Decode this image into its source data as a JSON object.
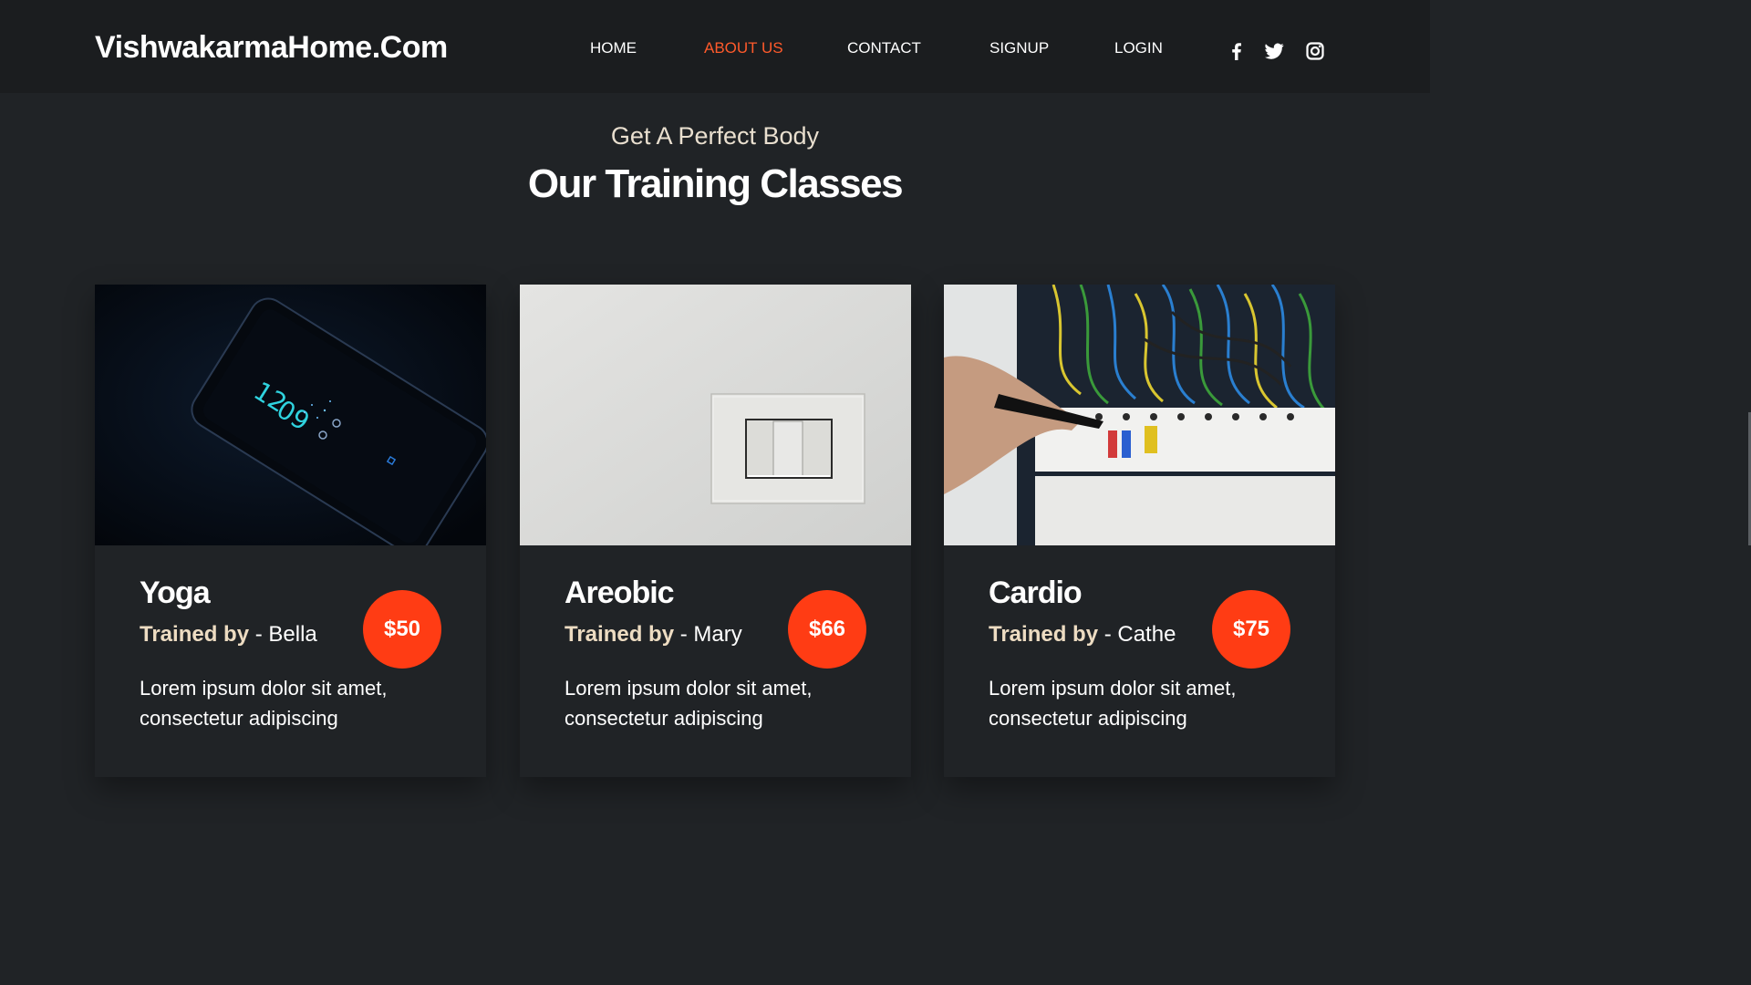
{
  "header": {
    "logo": "VishwakarmaHome.Com",
    "nav": [
      {
        "label": "HOME",
        "active": false
      },
      {
        "label": "ABOUT US",
        "active": true
      },
      {
        "label": "CONTACT",
        "active": false
      },
      {
        "label": "SIGNUP",
        "active": false
      },
      {
        "label": "LOGIN",
        "active": false
      }
    ],
    "social_icons": [
      "facebook-icon",
      "twitter-icon",
      "instagram-icon"
    ]
  },
  "section": {
    "subtitle": "Get A Perfect Body",
    "title": "Our Training Classes"
  },
  "classes": [
    {
      "title": "Yoga",
      "trained_by_label": "Trained by",
      "separator": " - ",
      "trainer": "Bella",
      "price": "$50",
      "description": "Lorem ipsum dolor sit amet, consectetur adipiscing",
      "image": "smartphone-photo"
    },
    {
      "title": "Areobic",
      "trained_by_label": "Trained by",
      "separator": " - ",
      "trainer": "Mary",
      "price": "$66",
      "description": "Lorem ipsum dolor sit amet, consectetur adipiscing",
      "image": "light-switch-photo"
    },
    {
      "title": "Cardio",
      "trained_by_label": "Trained by",
      "separator": " - ",
      "trainer": "Cathe",
      "price": "$75",
      "description": "Lorem ipsum dolor sit amet, consectetur adipiscing",
      "image": "electrical-panel-photo"
    }
  ],
  "colors": {
    "accent": "#ff5a2b",
    "badge": "#ff3c14",
    "background": "#202326",
    "navbar": "#1b1d1f"
  }
}
